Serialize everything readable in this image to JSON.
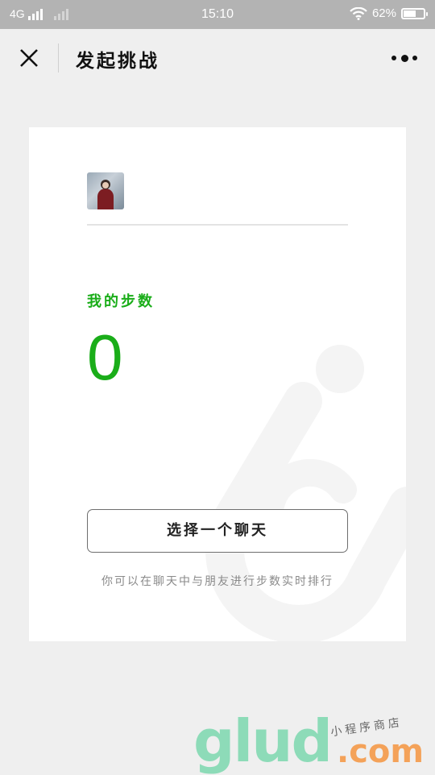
{
  "status_bar": {
    "network": "4G",
    "time": "15:10",
    "battery_percent": "62%",
    "battery_level": 0.62
  },
  "nav": {
    "title": "发起挑战"
  },
  "card": {
    "steps_label": "我的步数",
    "steps_value": "0",
    "choose_chat_button": "选择一个聊天",
    "hint": "你可以在聊天中与朋友进行步数实时排行"
  },
  "watermark": {
    "main": "glud",
    "com": ".com",
    "sub": "小程序商店"
  },
  "colors": {
    "accent": "#1aad19",
    "status_bar": "#b3b3b3",
    "background": "#efefef"
  }
}
